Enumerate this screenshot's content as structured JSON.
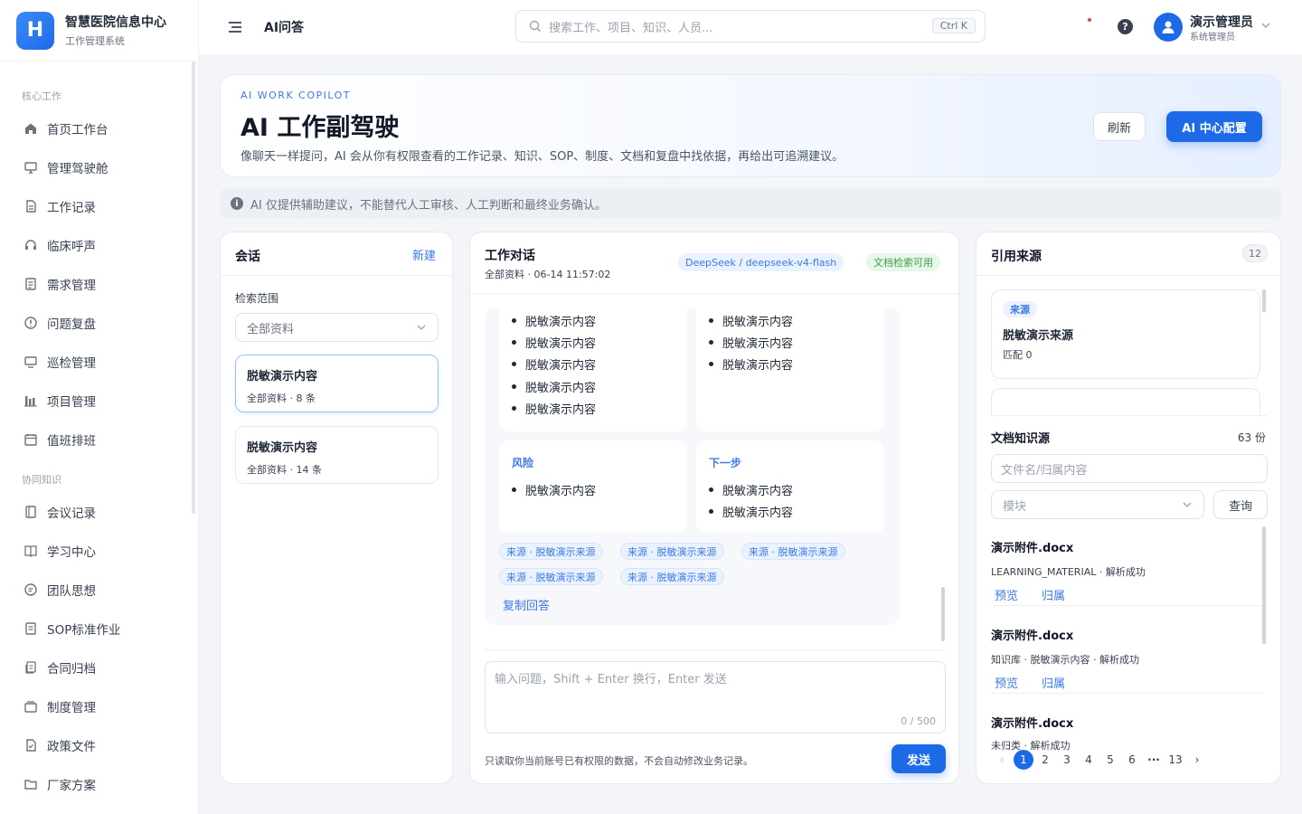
{
  "app": {
    "logo_letter": "H",
    "name": "智慧医院信息中心",
    "subtitle": "工作管理系统"
  },
  "sidebar": {
    "groups": [
      {
        "label": "核心工作"
      },
      {
        "label": "协同知识"
      }
    ],
    "items": [
      {
        "label": "首页工作台",
        "icon": "home-icon"
      },
      {
        "label": "管理驾驶舱",
        "icon": "dashboard-icon"
      },
      {
        "label": "工作记录",
        "icon": "document-icon"
      },
      {
        "label": "临床呼声",
        "icon": "headset-icon"
      },
      {
        "label": "需求管理",
        "icon": "list-icon"
      },
      {
        "label": "问题复盘",
        "icon": "alert-circle-icon"
      },
      {
        "label": "巡检管理",
        "icon": "monitor-icon"
      },
      {
        "label": "项目管理",
        "icon": "bar-chart-icon"
      },
      {
        "label": "值班排班",
        "icon": "calendar-icon"
      },
      {
        "label": "会议记录",
        "icon": "notes-icon"
      },
      {
        "label": "学习中心",
        "icon": "book-icon"
      },
      {
        "label": "团队思想",
        "icon": "chat-icon"
      },
      {
        "label": "SOP标准作业",
        "icon": "file-list-icon"
      },
      {
        "label": "合同归档",
        "icon": "archive-file-icon"
      },
      {
        "label": "制度管理",
        "icon": "folder-stack-icon"
      },
      {
        "label": "政策文件",
        "icon": "file-check-icon"
      },
      {
        "label": "厂家方案",
        "icon": "folder-icon"
      }
    ]
  },
  "topbar": {
    "page_title": "AI问答",
    "search_placeholder": "搜索工作、项目、知识、人员...",
    "shortcut": "Ctrl K",
    "help": "?",
    "user_name": "演示管理员",
    "user_role": "系统管理员"
  },
  "hero": {
    "kicker": "AI WORK COPILOT",
    "title": "AI 工作副驾驶",
    "description": "像聊天一样提问，AI 会从你有权限查看的工作记录、知识、SOP、制度、文档和复盘中找依据，再给出可追溯建议。",
    "refresh_label": "刷新",
    "config_label": "AI 中心配置"
  },
  "notice": {
    "icon": "i",
    "text": "AI 仅提供辅助建议，不能替代人工审核、人工判断和最终业务确认。"
  },
  "sessions": {
    "title": "会话",
    "new_label": "新建",
    "scope_label": "检索范围",
    "scope_value": "全部资料",
    "items": [
      {
        "title": "脱敏演示内容",
        "meta": "全部资料 · 8 条"
      },
      {
        "title": "脱敏演示内容",
        "meta": "全部资料 · 14 条"
      }
    ]
  },
  "chat": {
    "title": "工作对话",
    "meta": "全部资料 · 06-14 11:57:02",
    "model_tag": "DeepSeek / deepseek-v4-flash",
    "status_tag": "文档检索可用",
    "left_bullets": [
      "脱敏演示内容",
      "脱敏演示内容",
      "脱敏演示内容",
      "脱敏演示内容",
      "脱敏演示内容"
    ],
    "right_bullets": [
      "脱敏演示内容",
      "脱敏演示内容",
      "脱敏演示内容"
    ],
    "risk": {
      "title": "风险",
      "items": [
        "脱敏演示内容"
      ]
    },
    "next": {
      "title": "下一步",
      "items": [
        "脱敏演示内容",
        "脱敏演示内容"
      ]
    },
    "sources": [
      "来源 · 脱敏演示来源",
      "来源 · 脱敏演示来源",
      "来源 · 脱敏演示来源",
      "来源 · 脱敏演示来源",
      "来源 · 脱敏演示来源"
    ],
    "copy_label": "复制回答",
    "input_placeholder": "输入问题，Shift + Enter 换行，Enter 发送",
    "counter": "0 / 500",
    "footer_note": "只读取你当前账号已有权限的数据，不会自动修改业务记录。",
    "send_label": "发送"
  },
  "references": {
    "title": "引用来源",
    "count": "12",
    "card": {
      "tag": "来源",
      "title": "脱敏演示来源",
      "match": "匹配 0"
    },
    "docs_title": "文档知识源",
    "docs_count": "63 份",
    "filename_placeholder": "文件名/归属内容",
    "module_placeholder": "模块",
    "query_label": "查询",
    "docs": [
      {
        "name": "演示附件.docx",
        "meta": "LEARNING_MATERIAL · 解析成功",
        "preview": "预览",
        "owner": "归属"
      },
      {
        "name": "演示附件.docx",
        "meta": "知识库 · 脱敏演示内容 · 解析成功",
        "preview": "预览",
        "owner": "归属"
      },
      {
        "name": "演示附件.docx",
        "meta": "未归类 · 解析成功"
      }
    ],
    "pagination": {
      "prev": "‹",
      "pages": [
        "1",
        "2",
        "3",
        "4",
        "5",
        "6"
      ],
      "ellipsis": "···",
      "last": "13",
      "next": "›",
      "current": "1"
    }
  },
  "colors": {
    "primary": "#1d6ae8",
    "success": "#3aa14b",
    "danger": "#ef4444"
  }
}
